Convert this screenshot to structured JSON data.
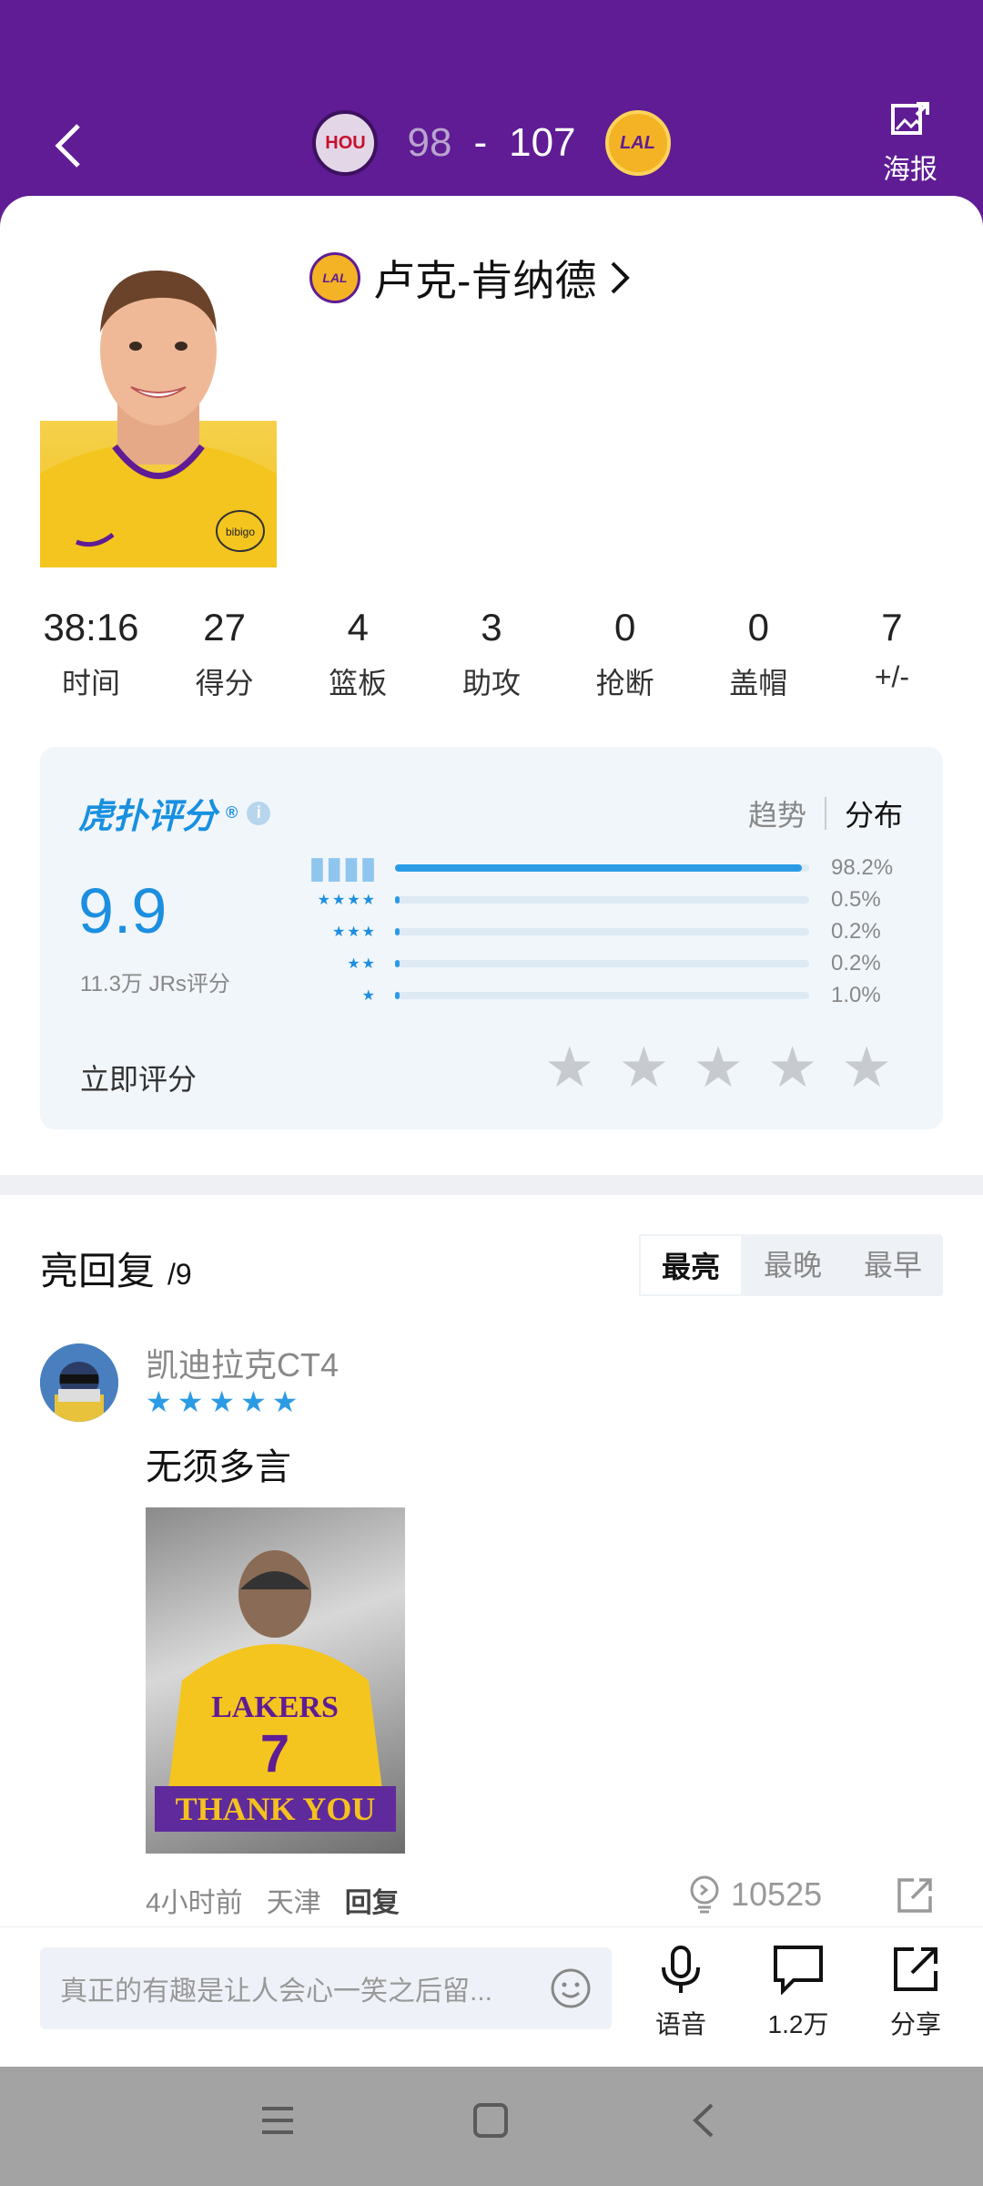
{
  "header": {
    "away_team": "HOU",
    "home_team": "LAL",
    "away_score": "98",
    "separator": "-",
    "home_score": "107",
    "poster_label": "海报"
  },
  "player": {
    "name": "卢克-肯纳德",
    "team_badge": "LAL",
    "jersey_sponsor": "bibigo"
  },
  "stats": [
    {
      "value": "38:16",
      "label": "时间"
    },
    {
      "value": "27",
      "label": "得分"
    },
    {
      "value": "4",
      "label": "篮板"
    },
    {
      "value": "3",
      "label": "助攻"
    },
    {
      "value": "0",
      "label": "抢断"
    },
    {
      "value": "0",
      "label": "盖帽"
    },
    {
      "value": "7",
      "label": "+/-"
    }
  ],
  "rating": {
    "brand": "虎扑评分",
    "brand_mark": "®",
    "tab_trend": "趋势",
    "tab_distribution": "分布",
    "score": "9.9",
    "votes": "11.3万 JRs评分",
    "distribution": [
      {
        "stars": 5,
        "percent": "98.2%",
        "fraction": 0.982
      },
      {
        "stars": 4,
        "percent": "0.5%",
        "fraction": 0.005
      },
      {
        "stars": 3,
        "percent": "0.2%",
        "fraction": 0.002
      },
      {
        "stars": 2,
        "percent": "0.2%",
        "fraction": 0.002
      },
      {
        "stars": 1,
        "percent": "1.0%",
        "fraction": 0.01
      }
    ],
    "rate_now": "立即评分"
  },
  "comments": {
    "title": "亮回复",
    "count": "/9",
    "sort_tabs": [
      "最亮",
      "最晚",
      "最早"
    ],
    "active_sort": "最亮",
    "items": [
      {
        "user": "凯迪拉克CT4",
        "star_rating": 5,
        "text": "无须多言",
        "image_caption": "THANK YOU",
        "time": "4小时前",
        "location": "天津",
        "reply_label": "回复",
        "likes": "10525"
      }
    ]
  },
  "bottom_bar": {
    "placeholder": "真正的有趣是让人会心一笑之后留...",
    "voice_label": "语音",
    "comments_count": "1.2万",
    "share_label": "分享"
  },
  "colors": {
    "header_purple": "#5f1c94",
    "accent_blue": "#1d8fe0",
    "lakers_gold": "#f4b324"
  }
}
